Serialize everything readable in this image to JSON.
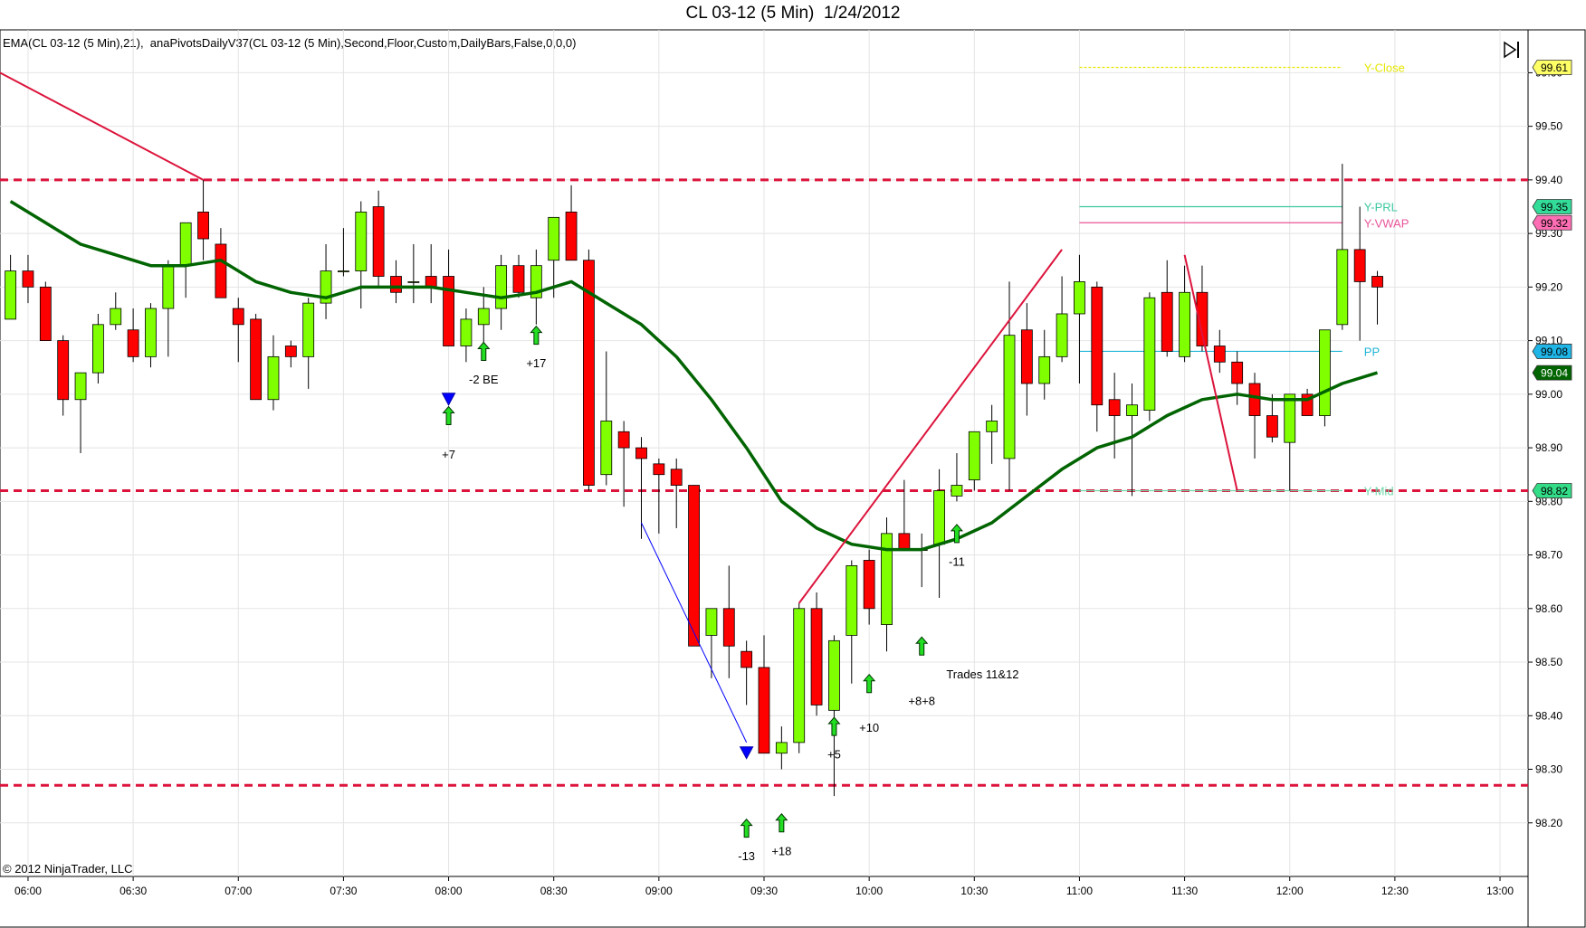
{
  "window": {
    "title": "CL 03-12 (5 Min)  1/24/2012",
    "indicator_caption": "EMA(CL 03-12 (5 Min),21),  anaPivotsDailyV37(CL 03-12 (5 Min),Second,Floor,Custom,DailyBars,False,0,0,0)",
    "copyright": "© 2012 NinjaTrader, LLC",
    "toolbar_icon": "play-to-end-icon"
  },
  "colors": {
    "bull": "#7fff00",
    "bear": "#ff0000",
    "ema": "#006400",
    "pivot_dash": "#dc143c",
    "grid": "#e4e4e4",
    "trend_line": "#dc143c",
    "blue_line": "#0000ff"
  },
  "chart_data": {
    "type": "candlestick",
    "instrument": "CL 03-12",
    "interval": "5 Min",
    "date": "1/24/2012",
    "x_range": [
      "05:52",
      "13:08"
    ],
    "ylim": [
      98.1,
      99.68
    ],
    "x_ticks": [
      "06:00",
      "06:30",
      "07:00",
      "07:30",
      "08:00",
      "08:30",
      "09:00",
      "09:30",
      "10:00",
      "10:30",
      "11:00",
      "11:30",
      "12:00",
      "12:30",
      "13:00"
    ],
    "y_ticks": [
      "98.20",
      "98.30",
      "98.40",
      "98.50",
      "98.60",
      "98.70",
      "98.80",
      "98.90",
      "99.00",
      "99.10",
      "99.20",
      "99.30",
      "99.40",
      "99.50",
      "99.60"
    ],
    "candles": [
      {
        "t": "05:55",
        "o": 99.14,
        "h": 99.26,
        "l": 99.14,
        "c": 99.23
      },
      {
        "t": "06:00",
        "o": 99.23,
        "h": 99.26,
        "l": 99.17,
        "c": 99.2
      },
      {
        "t": "06:05",
        "o": 99.2,
        "h": 99.21,
        "l": 99.1,
        "c": 99.1
      },
      {
        "t": "06:10",
        "o": 99.1,
        "h": 99.11,
        "l": 98.96,
        "c": 98.99
      },
      {
        "t": "06:15",
        "o": 98.99,
        "h": 99.04,
        "l": 98.89,
        "c": 99.04
      },
      {
        "t": "06:20",
        "o": 99.04,
        "h": 99.15,
        "l": 99.02,
        "c": 99.13
      },
      {
        "t": "06:25",
        "o": 99.13,
        "h": 99.19,
        "l": 99.12,
        "c": 99.16
      },
      {
        "t": "06:30",
        "o": 99.12,
        "h": 99.16,
        "l": 99.06,
        "c": 99.07
      },
      {
        "t": "06:35",
        "o": 99.07,
        "h": 99.17,
        "l": 99.05,
        "c": 99.16
      },
      {
        "t": "06:40",
        "o": 99.16,
        "h": 99.25,
        "l": 99.07,
        "c": 99.24
      },
      {
        "t": "06:45",
        "o": 99.24,
        "h": 99.32,
        "l": 99.18,
        "c": 99.32
      },
      {
        "t": "06:50",
        "o": 99.34,
        "h": 99.4,
        "l": 99.25,
        "c": 99.29
      },
      {
        "t": "06:55",
        "o": 99.28,
        "h": 99.31,
        "l": 99.18,
        "c": 99.18
      },
      {
        "t": "07:00",
        "o": 99.16,
        "h": 99.18,
        "l": 99.06,
        "c": 99.13
      },
      {
        "t": "07:05",
        "o": 99.14,
        "h": 99.15,
        "l": 98.99,
        "c": 98.99
      },
      {
        "t": "07:10",
        "o": 98.99,
        "h": 99.11,
        "l": 98.97,
        "c": 99.07
      },
      {
        "t": "07:15",
        "o": 99.09,
        "h": 99.1,
        "l": 99.05,
        "c": 99.07
      },
      {
        "t": "07:20",
        "o": 99.07,
        "h": 99.18,
        "l": 99.01,
        "c": 99.17
      },
      {
        "t": "07:25",
        "o": 99.17,
        "h": 99.28,
        "l": 99.14,
        "c": 99.23
      },
      {
        "t": "07:30",
        "o": 99.23,
        "h": 99.31,
        "l": 99.22,
        "c": 99.23
      },
      {
        "t": "07:35",
        "o": 99.23,
        "h": 99.36,
        "l": 99.16,
        "c": 99.34
      },
      {
        "t": "07:40",
        "o": 99.35,
        "h": 99.38,
        "l": 99.2,
        "c": 99.22
      },
      {
        "t": "07:45",
        "o": 99.22,
        "h": 99.25,
        "l": 99.17,
        "c": 99.19
      },
      {
        "t": "07:50",
        "o": 99.21,
        "h": 99.28,
        "l": 99.17,
        "c": 99.21
      },
      {
        "t": "07:55",
        "o": 99.22,
        "h": 99.28,
        "l": 99.17,
        "c": 99.2
      },
      {
        "t": "08:00",
        "o": 99.22,
        "h": 99.27,
        "l": 99.09,
        "c": 99.09
      },
      {
        "t": "08:05",
        "o": 99.09,
        "h": 99.16,
        "l": 99.06,
        "c": 99.14
      },
      {
        "t": "08:10",
        "o": 99.13,
        "h": 99.2,
        "l": 99.08,
        "c": 99.16
      },
      {
        "t": "08:15",
        "o": 99.16,
        "h": 99.26,
        "l": 99.12,
        "c": 99.24
      },
      {
        "t": "08:20",
        "o": 99.24,
        "h": 99.26,
        "l": 99.18,
        "c": 99.19
      },
      {
        "t": "08:25",
        "o": 99.18,
        "h": 99.27,
        "l": 99.13,
        "c": 99.24
      },
      {
        "t": "08:30",
        "o": 99.25,
        "h": 99.33,
        "l": 99.18,
        "c": 99.33
      },
      {
        "t": "08:35",
        "o": 99.34,
        "h": 99.39,
        "l": 99.25,
        "c": 99.25
      },
      {
        "t": "08:40",
        "o": 99.25,
        "h": 99.27,
        "l": 98.82,
        "c": 98.83
      },
      {
        "t": "08:45",
        "o": 98.85,
        "h": 99.08,
        "l": 98.83,
        "c": 98.95
      },
      {
        "t": "08:50",
        "o": 98.93,
        "h": 98.95,
        "l": 98.79,
        "c": 98.9
      },
      {
        "t": "08:55",
        "o": 98.9,
        "h": 98.92,
        "l": 98.73,
        "c": 98.88
      },
      {
        "t": "09:00",
        "o": 98.87,
        "h": 98.88,
        "l": 98.74,
        "c": 98.85
      },
      {
        "t": "09:05",
        "o": 98.86,
        "h": 98.88,
        "l": 98.75,
        "c": 98.83
      },
      {
        "t": "09:10",
        "o": 98.83,
        "h": 98.83,
        "l": 98.53,
        "c": 98.53
      },
      {
        "t": "09:15",
        "o": 98.55,
        "h": 98.6,
        "l": 98.47,
        "c": 98.6
      },
      {
        "t": "09:20",
        "o": 98.6,
        "h": 98.68,
        "l": 98.47,
        "c": 98.53
      },
      {
        "t": "09:25",
        "o": 98.52,
        "h": 98.54,
        "l": 98.42,
        "c": 98.49
      },
      {
        "t": "09:30",
        "o": 98.49,
        "h": 98.55,
        "l": 98.36,
        "c": 98.33
      },
      {
        "t": "09:35",
        "o": 98.33,
        "h": 98.38,
        "l": 98.3,
        "c": 98.35
      },
      {
        "t": "09:40",
        "o": 98.35,
        "h": 98.61,
        "l": 98.33,
        "c": 98.6
      },
      {
        "t": "09:45",
        "o": 98.6,
        "h": 98.63,
        "l": 98.4,
        "c": 98.42
      },
      {
        "t": "09:50",
        "o": 98.41,
        "h": 98.55,
        "l": 98.25,
        "c": 98.54
      },
      {
        "t": "09:55",
        "o": 98.55,
        "h": 98.69,
        "l": 98.46,
        "c": 98.68
      },
      {
        "t": "10:00",
        "o": 98.69,
        "h": 98.71,
        "l": 98.57,
        "c": 98.6
      },
      {
        "t": "10:05",
        "o": 98.57,
        "h": 98.77,
        "l": 98.52,
        "c": 98.74
      },
      {
        "t": "10:10",
        "o": 98.74,
        "h": 98.84,
        "l": 98.71,
        "c": 98.71
      },
      {
        "t": "10:15",
        "o": 98.71,
        "h": 98.74,
        "l": 98.64,
        "c": 98.71
      },
      {
        "t": "10:20",
        "o": 98.72,
        "h": 98.86,
        "l": 98.62,
        "c": 98.82
      },
      {
        "t": "10:25",
        "o": 98.81,
        "h": 98.89,
        "l": 98.8,
        "c": 98.83
      },
      {
        "t": "10:30",
        "o": 98.84,
        "h": 98.93,
        "l": 98.82,
        "c": 98.93
      },
      {
        "t": "10:35",
        "o": 98.93,
        "h": 98.98,
        "l": 98.87,
        "c": 98.95
      },
      {
        "t": "10:40",
        "o": 98.88,
        "h": 99.21,
        "l": 98.82,
        "c": 99.11
      },
      {
        "t": "10:45",
        "o": 99.12,
        "h": 99.17,
        "l": 98.96,
        "c": 99.02
      },
      {
        "t": "10:50",
        "o": 99.02,
        "h": 99.12,
        "l": 98.99,
        "c": 99.07
      },
      {
        "t": "10:55",
        "o": 99.07,
        "h": 99.22,
        "l": 99.06,
        "c": 99.15
      },
      {
        "t": "11:00",
        "o": 99.15,
        "h": 99.26,
        "l": 99.02,
        "c": 99.21
      },
      {
        "t": "11:05",
        "o": 99.2,
        "h": 99.21,
        "l": 98.93,
        "c": 98.98
      },
      {
        "t": "11:10",
        "o": 98.99,
        "h": 99.04,
        "l": 98.88,
        "c": 98.96
      },
      {
        "t": "11:15",
        "o": 98.96,
        "h": 99.02,
        "l": 98.81,
        "c": 98.98
      },
      {
        "t": "11:20",
        "o": 98.97,
        "h": 99.19,
        "l": 98.95,
        "c": 99.18
      },
      {
        "t": "11:25",
        "o": 99.19,
        "h": 99.25,
        "l": 99.07,
        "c": 99.08
      },
      {
        "t": "11:30",
        "o": 99.07,
        "h": 99.24,
        "l": 99.06,
        "c": 99.19
      },
      {
        "t": "11:35",
        "o": 99.19,
        "h": 99.24,
        "l": 99.08,
        "c": 99.09
      },
      {
        "t": "11:40",
        "o": 99.09,
        "h": 99.12,
        "l": 99.04,
        "c": 99.06
      },
      {
        "t": "11:45",
        "o": 99.06,
        "h": 99.08,
        "l": 98.98,
        "c": 99.02
      },
      {
        "t": "11:50",
        "o": 99.02,
        "h": 99.04,
        "l": 98.88,
        "c": 98.96
      },
      {
        "t": "11:55",
        "o": 98.96,
        "h": 99.0,
        "l": 98.91,
        "c": 98.92
      },
      {
        "t": "12:00",
        "o": 98.91,
        "h": 99.0,
        "l": 98.82,
        "c": 99.0
      },
      {
        "t": "12:05",
        "o": 99.0,
        "h": 99.01,
        "l": 98.96,
        "c": 98.96
      },
      {
        "t": "12:10",
        "o": 98.96,
        "h": 99.12,
        "l": 98.94,
        "c": 99.12
      },
      {
        "t": "12:15",
        "o": 99.13,
        "h": 99.43,
        "l": 99.12,
        "c": 99.27
      },
      {
        "t": "12:20",
        "o": 99.27,
        "h": 99.35,
        "l": 99.1,
        "c": 99.21
      },
      {
        "t": "12:25",
        "o": 99.22,
        "h": 99.23,
        "l": 99.13,
        "c": 99.2
      }
    ],
    "ema21": [
      {
        "t": "05:55",
        "v": 99.36
      },
      {
        "t": "06:05",
        "v": 99.32
      },
      {
        "t": "06:15",
        "v": 99.28
      },
      {
        "t": "06:25",
        "v": 99.26
      },
      {
        "t": "06:35",
        "v": 99.24
      },
      {
        "t": "06:45",
        "v": 99.24
      },
      {
        "t": "06:55",
        "v": 99.25
      },
      {
        "t": "07:05",
        "v": 99.21
      },
      {
        "t": "07:15",
        "v": 99.19
      },
      {
        "t": "07:25",
        "v": 99.18
      },
      {
        "t": "07:35",
        "v": 99.2
      },
      {
        "t": "07:45",
        "v": 99.2
      },
      {
        "t": "07:55",
        "v": 99.2
      },
      {
        "t": "08:05",
        "v": 99.19
      },
      {
        "t": "08:15",
        "v": 99.18
      },
      {
        "t": "08:25",
        "v": 99.19
      },
      {
        "t": "08:35",
        "v": 99.21
      },
      {
        "t": "08:45",
        "v": 99.17
      },
      {
        "t": "08:55",
        "v": 99.13
      },
      {
        "t": "09:05",
        "v": 99.07
      },
      {
        "t": "09:15",
        "v": 98.99
      },
      {
        "t": "09:25",
        "v": 98.9
      },
      {
        "t": "09:35",
        "v": 98.8
      },
      {
        "t": "09:45",
        "v": 98.75
      },
      {
        "t": "09:55",
        "v": 98.72
      },
      {
        "t": "10:05",
        "v": 98.71
      },
      {
        "t": "10:15",
        "v": 98.71
      },
      {
        "t": "10:25",
        "v": 98.73
      },
      {
        "t": "10:35",
        "v": 98.76
      },
      {
        "t": "10:45",
        "v": 98.81
      },
      {
        "t": "10:55",
        "v": 98.86
      },
      {
        "t": "11:05",
        "v": 98.9
      },
      {
        "t": "11:15",
        "v": 98.92
      },
      {
        "t": "11:25",
        "v": 98.96
      },
      {
        "t": "11:35",
        "v": 98.99
      },
      {
        "t": "11:45",
        "v": 99.0
      },
      {
        "t": "11:55",
        "v": 98.99
      },
      {
        "t": "12:05",
        "v": 98.99
      },
      {
        "t": "12:15",
        "v": 99.02
      },
      {
        "t": "12:25",
        "v": 99.04
      }
    ],
    "pivot_dashed_lines": [
      99.4,
      98.82,
      98.27
    ],
    "pivot_levels": [
      {
        "label": "Y-Close",
        "value": 99.61,
        "color": "#e6e600",
        "badge": "99.61",
        "badge_bg": "#ffff66",
        "badge_fg": "#000000",
        "start": "11:00",
        "end": "12:15",
        "line_value": 99.61,
        "label_value": 99.61
      },
      {
        "label": "Y-PRL",
        "value": 99.35,
        "color": "#3cc8a0",
        "badge": "99.35",
        "badge_bg": "#33dd99",
        "badge_fg": "#000000",
        "start": "11:00",
        "end": "12:15",
        "line_value": 99.35,
        "label_value": 99.35
      },
      {
        "label": "Y-VWAP",
        "value": 99.32,
        "color": "#e8559a",
        "badge": "99.32",
        "badge_bg": "#ff6eb4",
        "badge_fg": "#000000",
        "start": "11:00",
        "end": "12:15",
        "line_value": 99.32,
        "label_value": 99.32
      },
      {
        "label": "PP",
        "value": 99.08,
        "color": "#1fb5d6",
        "badge": "99.08",
        "badge_bg": "#1fb5e6",
        "badge_fg": "#000000",
        "start": "11:00",
        "end": "12:15",
        "line_value": 99.08,
        "label_value": 99.08
      },
      {
        "label": "Y-Mid",
        "value": 98.82,
        "color": "#6fd6a8",
        "badge": "98.82",
        "badge_bg": "#33dd88",
        "badge_fg": "#000000",
        "start": "11:00",
        "end": "12:15",
        "line_value": 98.82,
        "label_value": 98.82
      }
    ],
    "ema_badge": {
      "text": "99.04",
      "value": 99.04,
      "bg": "#006400",
      "fg": "#ffffff"
    },
    "trend_lines": [
      {
        "from": {
          "t": "05:52",
          "v": 99.6
        },
        "to": {
          "t": "06:50",
          "v": 99.4
        },
        "color": "#dc143c"
      },
      {
        "from": {
          "t": "09:40",
          "v": 98.61
        },
        "to": {
          "t": "10:55",
          "v": 99.27
        },
        "color": "#dc143c"
      },
      {
        "from": {
          "t": "11:30",
          "v": 99.26
        },
        "to": {
          "t": "11:45",
          "v": 98.82
        },
        "color": "#dc143c"
      },
      {
        "from": {
          "t": "08:55",
          "v": 98.76
        },
        "to": {
          "t": "09:25",
          "v": 98.35
        },
        "color": "#0000ff"
      }
    ],
    "markers": [
      {
        "kind": "up",
        "t": "08:00",
        "v": 98.96
      },
      {
        "kind": "down",
        "t": "08:00",
        "v": 98.99
      },
      {
        "kind": "up",
        "t": "08:10",
        "v": 99.08
      },
      {
        "kind": "up",
        "t": "08:25",
        "v": 99.11
      },
      {
        "kind": "down",
        "t": "09:25",
        "v": 98.33
      },
      {
        "kind": "up",
        "t": "09:25",
        "v": 98.19
      },
      {
        "kind": "up",
        "t": "09:35",
        "v": 98.2
      },
      {
        "kind": "up",
        "t": "09:50",
        "v": 98.38
      },
      {
        "kind": "up",
        "t": "10:00",
        "v": 98.46
      },
      {
        "kind": "up",
        "t": "10:15",
        "v": 98.53
      },
      {
        "kind": "up",
        "t": "10:25",
        "v": 98.74
      }
    ],
    "annotations": [
      {
        "text": "+7",
        "t": "08:00",
        "v": 98.88
      },
      {
        "text": "-2 BE",
        "t": "08:10",
        "v": 99.02
      },
      {
        "text": "+17",
        "t": "08:25",
        "v": 99.05
      },
      {
        "text": "-13",
        "t": "09:25",
        "v": 98.13
      },
      {
        "text": "+18",
        "t": "09:35",
        "v": 98.14
      },
      {
        "text": "+5",
        "t": "09:50",
        "v": 98.32
      },
      {
        "text": "+10",
        "t": "10:00",
        "v": 98.37
      },
      {
        "text": "Trades 11&12",
        "t": "10:22",
        "v": 98.47
      },
      {
        "text": "+8+8",
        "t": "10:15",
        "v": 98.42
      },
      {
        "text": "-11",
        "t": "10:25",
        "v": 98.68
      }
    ]
  }
}
